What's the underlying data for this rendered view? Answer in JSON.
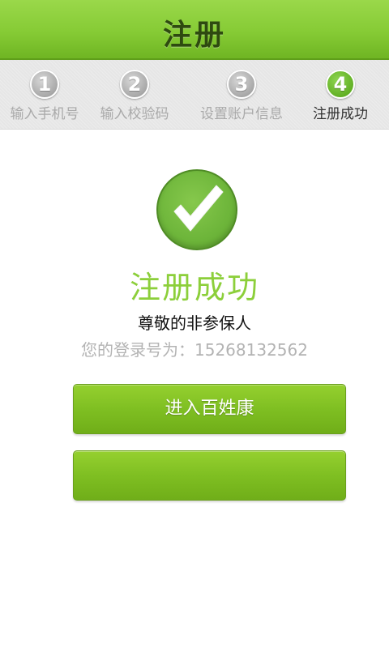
{
  "header": {
    "title": "注册"
  },
  "steps": [
    {
      "number": "1",
      "label": "输入手机号",
      "active": false
    },
    {
      "number": "2",
      "label": "输入校验码",
      "active": false
    },
    {
      "number": "3",
      "label": "设置账户信息",
      "active": false
    },
    {
      "number": "4",
      "label": "注册成功",
      "active": true
    }
  ],
  "success": {
    "icon": "checkmark-icon",
    "title": "注册成功",
    "name": "尊敬的非参保人",
    "account_prefix": "您的登录号为：",
    "account_number": "15268132562"
  },
  "buttons": {
    "primary_label": "进入百姓康",
    "secondary_label": ""
  },
  "colors": {
    "brand_green": "#86cb35",
    "success_text": "#8ccf3a",
    "inactive_step": "#a9a9a9"
  }
}
